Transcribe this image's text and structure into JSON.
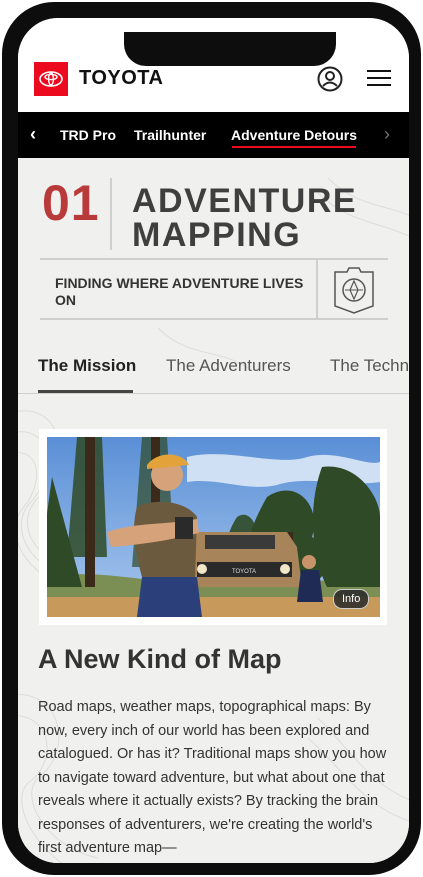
{
  "header": {
    "brand": "TOYOTA",
    "account_icon": "account-icon",
    "menu_icon": "hamburger-menu-icon",
    "brand_color": "#eb0a1e"
  },
  "subnav": {
    "items": [
      "TRD Pro",
      "Trailhunter",
      "Adventure Detours"
    ],
    "active": "Adventure Detours"
  },
  "hero": {
    "number": "01",
    "title_line1": "ADVENTURE",
    "title_line2": "MAPPING",
    "subtitle": "FINDING WHERE ADVENTURE LIVES ON",
    "badge_icon": "compass-badge-icon"
  },
  "tabs": {
    "items": [
      "The Mission",
      "The Adventurers",
      "The Techn"
    ],
    "active": "The Mission"
  },
  "photo": {
    "info_label": "Info",
    "plate_text": "TOYOTA"
  },
  "article": {
    "headline": "A New Kind of Map",
    "body": "Road maps, weather maps, topographical maps: By now, every inch of our world has been explored and catalogued. Or has it? Traditional maps show you how to navigate toward adventure, but what about one that reveals where it actually exists? By tracking the brain responses of adventurers, we're creating the world's first adventure map—"
  }
}
